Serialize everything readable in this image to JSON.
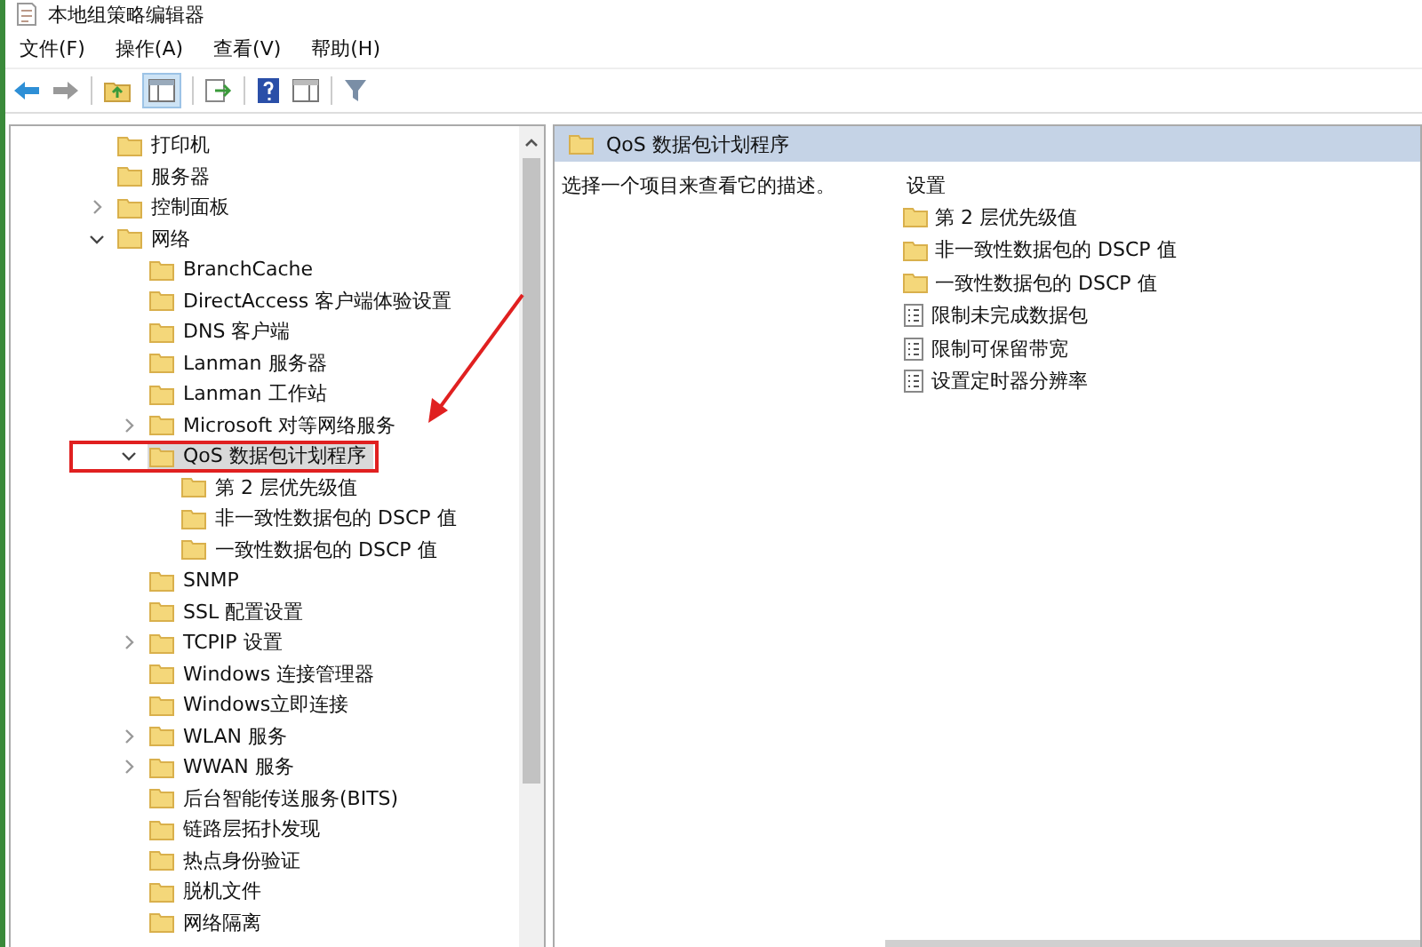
{
  "window": {
    "title": "本地组策略编辑器"
  },
  "menu": [
    "文件(F)",
    "操作(A)",
    "查看(V)",
    "帮助(H)"
  ],
  "tree": [
    {
      "label": "打印机",
      "selected": false
    },
    {
      "label": "服务器",
      "selected": false
    },
    {
      "label": "控制面板",
      "selected": false,
      "expanded": false
    },
    {
      "label": "网络",
      "selected": false,
      "expanded": true,
      "children": [
        {
          "label": "BranchCache",
          "selected": false
        },
        {
          "label": "DirectAccess 客户端体验设置",
          "selected": false
        },
        {
          "label": "DNS 客户端",
          "selected": false
        },
        {
          "label": "Lanman 服务器",
          "selected": false
        },
        {
          "label": "Lanman 工作站",
          "selected": false
        },
        {
          "label": "Microsoft 对等网络服务",
          "selected": false,
          "expanded": false
        },
        {
          "label": "QoS 数据包计划程序",
          "selected": true,
          "expanded": true,
          "children": [
            {
              "label": "第 2 层优先级值",
              "selected": false
            },
            {
              "label": "非一致性数据包的 DSCP 值",
              "selected": false
            },
            {
              "label": "一致性数据包的 DSCP 值",
              "selected": false
            }
          ]
        },
        {
          "label": "SNMP",
          "selected": false
        },
        {
          "label": "SSL 配置设置",
          "selected": false
        },
        {
          "label": "TCPIP 设置",
          "selected": false,
          "expanded": false
        },
        {
          "label": "Windows 连接管理器",
          "selected": false
        },
        {
          "label": "Windows立即连接",
          "selected": false
        },
        {
          "label": "WLAN 服务",
          "selected": false,
          "expanded": false
        },
        {
          "label": "WWAN 服务",
          "selected": false,
          "expanded": false
        },
        {
          "label": "后台智能传送服务(BITS)",
          "selected": false
        },
        {
          "label": "链路层拓扑发现",
          "selected": false
        },
        {
          "label": "热点身份验证",
          "selected": false
        },
        {
          "label": "脱机文件",
          "selected": false
        },
        {
          "label": "网络隔离",
          "selected": false
        }
      ]
    }
  ],
  "details": {
    "header": "QoS 数据包计划程序",
    "description": "选择一个项目来查看它的描述。",
    "column": "设置",
    "items": [
      {
        "kind": "folder",
        "label": "第 2 层优先级值"
      },
      {
        "kind": "folder",
        "label": "非一致性数据包的 DSCP 值"
      },
      {
        "kind": "folder",
        "label": "一致性数据包的 DSCP 值"
      },
      {
        "kind": "setting",
        "label": "限制未完成数据包"
      },
      {
        "kind": "setting",
        "label": "限制可保留带宽"
      },
      {
        "kind": "setting",
        "label": "设置定时器分辨率"
      }
    ]
  }
}
